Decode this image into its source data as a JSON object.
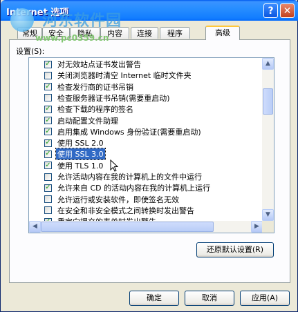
{
  "window": {
    "title": "Internet 选项",
    "help_glyph": "?",
    "close_glyph": "✕"
  },
  "watermark": {
    "site_name": "河东软件园",
    "url": "www.pc0359.cn"
  },
  "tabs": [
    {
      "label": "常规"
    },
    {
      "label": "安全"
    },
    {
      "label": "隐私"
    },
    {
      "label": "内容"
    },
    {
      "label": "连接"
    },
    {
      "label": "程序"
    },
    {
      "label": "高级"
    }
  ],
  "settings_label": "设置(S):",
  "settings": [
    {
      "label": "对无效站点证书发出警告",
      "checked": true
    },
    {
      "label": "关闭浏览器时清空 Internet 临时文件夹",
      "checked": false
    },
    {
      "label": "检查发行商的证书吊销",
      "checked": true
    },
    {
      "label": "检查服务器证书吊销(需要重启动)",
      "checked": false
    },
    {
      "label": "检查下载的程序的签名",
      "checked": true
    },
    {
      "label": "启动配置文件助理",
      "checked": true
    },
    {
      "label": "启用集成 Windows 身份验证(需要重启动)",
      "checked": true
    },
    {
      "label": "使用 SSL 2.0",
      "checked": true
    },
    {
      "label": "使用 SSL 3.0",
      "checked": true,
      "selected": true
    },
    {
      "label": "使用 TLS 1.0",
      "checked": true
    },
    {
      "label": "允许活动内容在我的计算机上的文件中运行",
      "checked": false
    },
    {
      "label": "允许来自 CD 的活动内容在我的计算机上运行",
      "checked": true
    },
    {
      "label": "允许运行或安装软件，即使签名无效",
      "checked": false
    },
    {
      "label": "在安全和非安全模式之间转换时发出警告",
      "checked": false
    },
    {
      "label": "重定向提交的表单时发出警告",
      "checked": true
    }
  ],
  "scroll_glyphs": {
    "up": "▲",
    "down": "▼",
    "left": "◀",
    "right": "▶"
  },
  "restore_button": "还原默认设置(R)",
  "buttons": {
    "ok": "确定",
    "cancel": "取消",
    "apply": "应用(A)"
  },
  "colors": {
    "title_bar": "#0054e3",
    "selection": "#316ac5",
    "check": "#21a121",
    "active_tab_accent": "#ffc83c"
  }
}
